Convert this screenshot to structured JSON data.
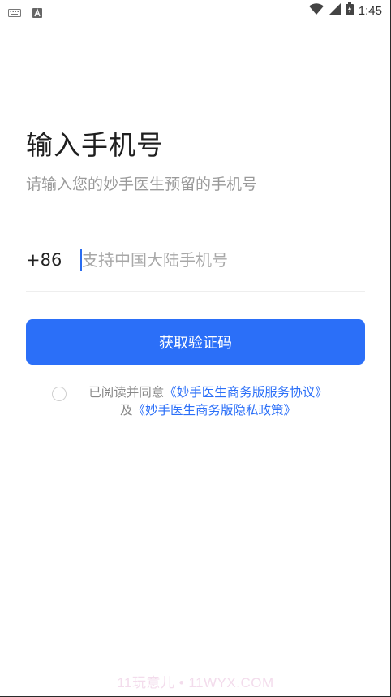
{
  "status_bar": {
    "time": "1:45",
    "left_icons": [
      "keyboard-icon",
      "text-notification-icon"
    ],
    "right_icons": [
      "wifi-icon",
      "signal-icon",
      "battery-icon"
    ]
  },
  "header": {
    "title": "输入手机号",
    "subtitle": "请输入您的妙手医生预留的手机号"
  },
  "phone": {
    "country_code": "+86",
    "placeholder": "支持中国大陆手机号",
    "value": ""
  },
  "actions": {
    "get_code_label": "获取验证码"
  },
  "agreement": {
    "prefix": "已阅读并同意",
    "service_agreement": "《妙手医生商务版服务协议》",
    "conjunction": "及",
    "privacy_policy": "《妙手医生商务版隐私政策》",
    "checked": false
  },
  "watermark": "11玩意儿 • 11WYX.COM",
  "colors": {
    "accent": "#2b6ff8",
    "title": "#1f1f1f",
    "muted": "#9a9a9a"
  }
}
